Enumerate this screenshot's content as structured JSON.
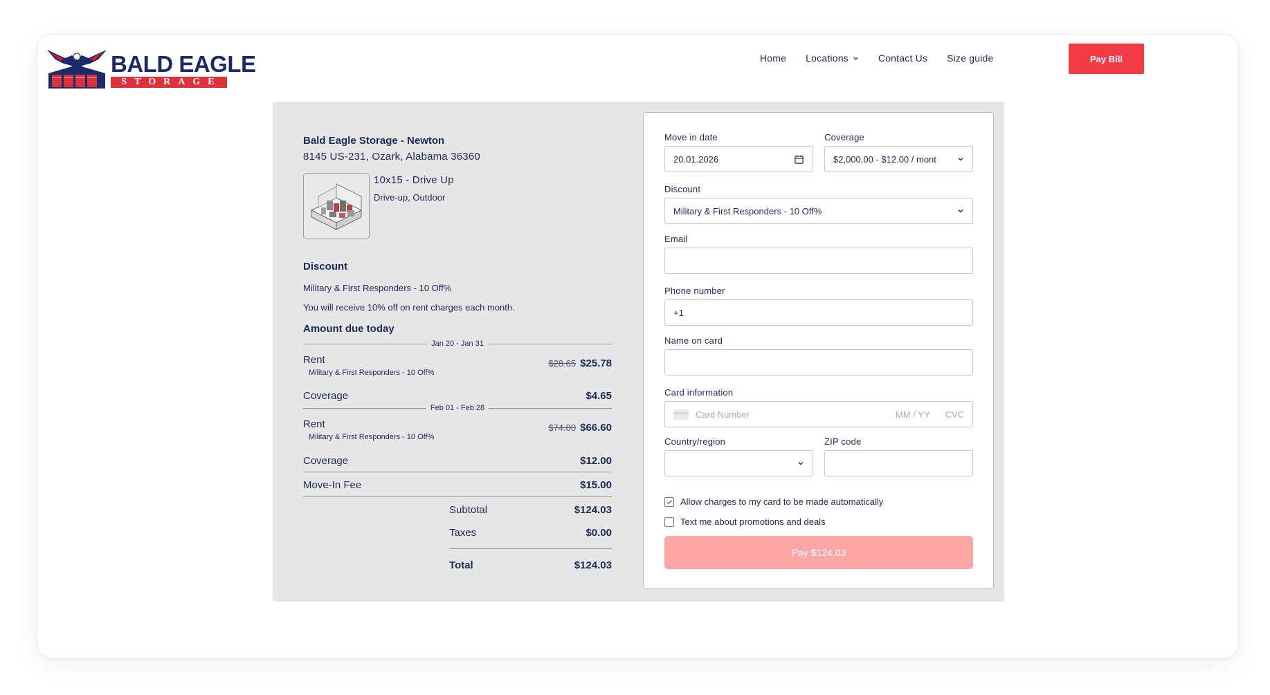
{
  "brand": {
    "name": "BALD EAGLE",
    "sub": "STORAGE"
  },
  "nav": {
    "items": [
      {
        "label": "Home",
        "has_dropdown": false
      },
      {
        "label": "Locations",
        "has_dropdown": true
      },
      {
        "label": "Contact Us",
        "has_dropdown": false
      },
      {
        "label": "Size guide",
        "has_dropdown": false
      }
    ],
    "pay_bill_label": "Pay Bill"
  },
  "summary": {
    "location_name": "Bald Eagle Storage - Newton",
    "address": "8145 US-231, Ozark, Alabama 36360",
    "unit_title": "10x15 - Drive Up",
    "unit_type": "Drive-up, Outdoor",
    "discount_title": "Discount",
    "discount_name": "Military & First Responders - 10 Off%",
    "discount_desc": "You will receive 10% off on rent charges each month.",
    "amount_title": "Amount due today",
    "period1": "Jan 20 - Jan 31",
    "rent1": {
      "label": "Rent",
      "sub": "Military & First Responders - 10 Off%",
      "old": "$28.65",
      "amount": "$25.78"
    },
    "coverage1": {
      "label": "Coverage",
      "amount": "$4.65"
    },
    "period2": "Feb 01 - Feb 28",
    "rent2": {
      "label": "Rent",
      "sub": "Military & First Responders - 10 Off%",
      "old": "$74.00",
      "amount": "$66.60"
    },
    "coverage2": {
      "label": "Coverage",
      "amount": "$12.00"
    },
    "move_in_fee": {
      "label": "Move-In Fee",
      "amount": "$15.00"
    },
    "subtotal": {
      "label": "Subtotal",
      "amount": "$124.03"
    },
    "taxes": {
      "label": "Taxes",
      "amount": "$0.00"
    },
    "total": {
      "label": "Total",
      "amount": "$124.03"
    }
  },
  "form": {
    "move_in_label": "Move in date",
    "move_in_value": "20.01.2026",
    "coverage_label": "Coverage",
    "coverage_value": "$2,000.00 - $12.00 / mont",
    "discount_label": "Discount",
    "discount_value": "Military & First Responders - 10 Off%",
    "email_label": "Email",
    "email_value": "",
    "phone_label": "Phone number",
    "phone_value": "+1",
    "name_label": "Name on card",
    "name_value": "",
    "card_label": "Card information",
    "card_placeholder": "Card Number",
    "card_expiry_placeholder": "MM / YY",
    "card_cvc_placeholder": "CVC",
    "country_label": "Country/region",
    "country_value": "",
    "zip_label": "ZIP code",
    "zip_value": "",
    "auto_charge_label": "Allow charges to my card to be made automatically",
    "auto_charge_checked": true,
    "promo_label": "Text me about promotions and deals",
    "promo_checked": false,
    "pay_label": "Pay $124.03"
  },
  "colors": {
    "primary_text": "#1c2a57",
    "accent_red": "#f33b45",
    "pay_disabled": "#fca6a6",
    "panel_bg": "#e6e6e6"
  }
}
